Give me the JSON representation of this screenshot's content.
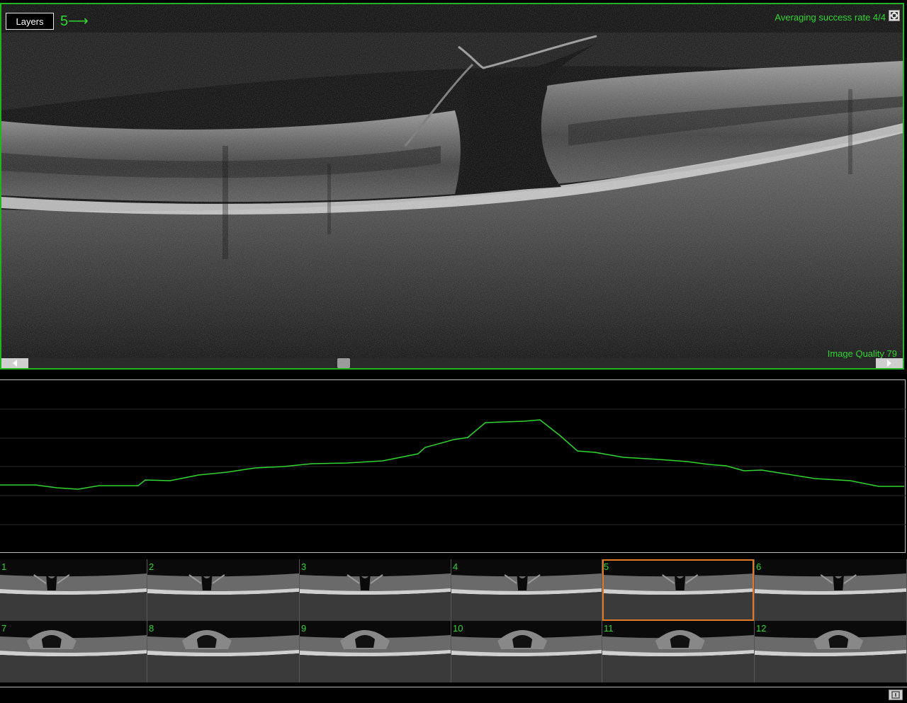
{
  "viewer": {
    "layers_label": "Layers",
    "slice_indicator": "5⟶",
    "averaging_label": "Averaging success rate 4/4",
    "image_quality_label": "Image Quality 79",
    "scroll_position": 0.37
  },
  "profile": {
    "line_color": "#2fd62f",
    "points": [
      [
        0,
        684
      ],
      [
        50,
        684
      ],
      [
        80,
        688
      ],
      [
        110,
        690
      ],
      [
        140,
        685
      ],
      [
        195,
        685
      ],
      [
        205,
        677
      ],
      [
        240,
        678
      ],
      [
        280,
        670
      ],
      [
        320,
        666
      ],
      [
        360,
        660
      ],
      [
        400,
        658
      ],
      [
        440,
        654
      ],
      [
        490,
        653
      ],
      [
        540,
        650
      ],
      [
        590,
        640
      ],
      [
        600,
        631
      ],
      [
        640,
        620
      ],
      [
        660,
        617
      ],
      [
        685,
        596
      ],
      [
        710,
        595
      ],
      [
        740,
        594
      ],
      [
        762,
        592
      ],
      [
        790,
        614
      ],
      [
        815,
        636
      ],
      [
        840,
        638
      ],
      [
        880,
        645
      ],
      [
        930,
        648
      ],
      [
        970,
        651
      ],
      [
        1000,
        655
      ],
      [
        1025,
        657
      ],
      [
        1050,
        664
      ],
      [
        1075,
        663
      ],
      [
        1100,
        667
      ],
      [
        1150,
        675
      ],
      [
        1200,
        678
      ],
      [
        1240,
        686
      ],
      [
        1276,
        686
      ]
    ]
  },
  "thumbnails": [
    {
      "label": "1"
    },
    {
      "label": "2"
    },
    {
      "label": "3"
    },
    {
      "label": "4"
    },
    {
      "label": "5"
    },
    {
      "label": "6"
    },
    {
      "label": "7"
    },
    {
      "label": "8"
    },
    {
      "label": "9"
    },
    {
      "label": "10"
    },
    {
      "label": "11"
    },
    {
      "label": "12"
    }
  ],
  "selected_thumbnail": "5",
  "colors": {
    "accent_green": "#2fd62f",
    "selection_orange": "#e07a26",
    "frame_green": "#22b422"
  }
}
